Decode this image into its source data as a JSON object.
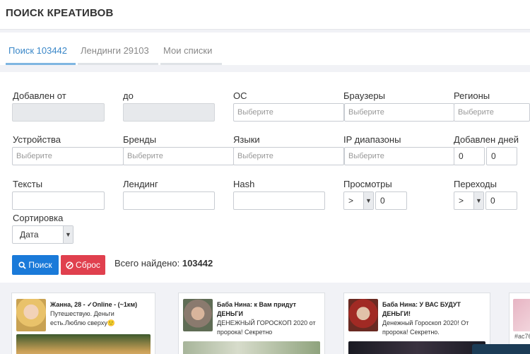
{
  "header": {
    "title": "ПОИСК КРЕАТИВОВ"
  },
  "tabs": [
    {
      "label": "Поиск 103442",
      "active": true
    },
    {
      "label": "Лендинги 29103",
      "active": false
    },
    {
      "label": "Мои списки",
      "active": false
    }
  ],
  "filters": {
    "added_from": {
      "label": "Добавлен от",
      "value": ""
    },
    "added_to": {
      "label": "до",
      "value": ""
    },
    "os": {
      "label": "ОС",
      "placeholder": "Выберите"
    },
    "browsers": {
      "label": "Браузеры",
      "placeholder": "Выберите"
    },
    "regions": {
      "label": "Регионы",
      "placeholder": "Выберите"
    },
    "devices": {
      "label": "Устройства",
      "placeholder": "Выберите"
    },
    "brands": {
      "label": "Бренды",
      "placeholder": "Выберите"
    },
    "languages": {
      "label": "Языки",
      "placeholder": "Выберите"
    },
    "ip_ranges": {
      "label": "IP диапазоны",
      "placeholder": "Выберите"
    },
    "added_days": {
      "label": "Добавлен дней",
      "from": "0",
      "to": "0"
    },
    "texts": {
      "label": "Тексты",
      "value": ""
    },
    "landing": {
      "label": "Лендинг",
      "value": ""
    },
    "hash": {
      "label": "Hash",
      "value": ""
    },
    "views": {
      "label": "Просмотры",
      "operator": ">",
      "value": "0"
    },
    "clicks": {
      "label": "Переходы",
      "operator": ">",
      "value": "0"
    },
    "sort": {
      "label": "Сортировка",
      "value": "Дата"
    }
  },
  "actions": {
    "search_label": "Поиск",
    "reset_label": "Сброс",
    "total_label": "Всего найдено:",
    "total_value": "103442"
  },
  "cards": [
    {
      "title": "Жанна, 28 - ✓Online - (~1км)",
      "text_lines": [
        "Путешествую. Деньги",
        "есть.Люблю сверху🙂"
      ]
    },
    {
      "title": "Баба Нина: к Вам придут ДЕНЬГИ",
      "text_lines": [
        "ДЕНЕЖНЫЙ ГОРОСКОП 2020 от",
        "пророка! Секретно"
      ]
    },
    {
      "title": "Баба Нина: У ВАС БУДУТ ДЕНЬГИ!",
      "text_lines": [
        "Денежный Гороскоп 2020! От",
        "пророка! Секретно."
      ]
    }
  ],
  "partial_card_tag": "#ac76",
  "icons": {
    "search": "search-icon",
    "reset": "reset-icon",
    "dropdown": "chevron-down-icon"
  },
  "colors": {
    "primary": "#1a7ad9",
    "danger": "#e0404e",
    "active_tab": "#3a87c8"
  }
}
